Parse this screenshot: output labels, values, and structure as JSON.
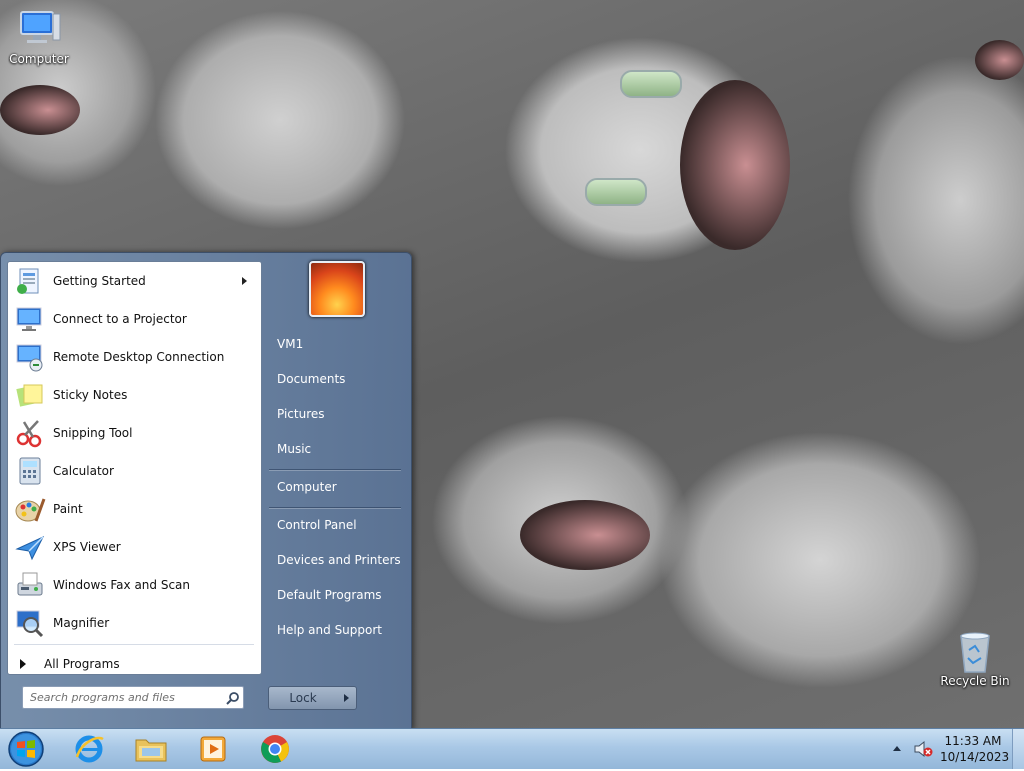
{
  "desktop": {
    "icons": [
      {
        "label": "Computer",
        "icon": "computer-icon"
      },
      {
        "label": "Recycle Bin",
        "icon": "recycle-bin-icon"
      }
    ]
  },
  "start_menu": {
    "programs": [
      {
        "label": "Getting Started",
        "icon": "getting-started-icon",
        "has_submenu": true
      },
      {
        "label": "Connect to a Projector",
        "icon": "projector-icon"
      },
      {
        "label": "Remote Desktop Connection",
        "icon": "remote-desktop-icon"
      },
      {
        "label": "Sticky Notes",
        "icon": "sticky-notes-icon"
      },
      {
        "label": "Snipping Tool",
        "icon": "snipping-tool-icon"
      },
      {
        "label": "Calculator",
        "icon": "calculator-icon"
      },
      {
        "label": "Paint",
        "icon": "paint-icon"
      },
      {
        "label": "XPS Viewer",
        "icon": "xps-viewer-icon"
      },
      {
        "label": "Windows Fax and Scan",
        "icon": "fax-scan-icon"
      },
      {
        "label": "Magnifier",
        "icon": "magnifier-icon"
      }
    ],
    "all_programs": "All Programs",
    "search_placeholder": "Search programs and files",
    "right_links": [
      {
        "label": "VM1"
      },
      {
        "label": "Documents"
      },
      {
        "label": "Pictures"
      },
      {
        "label": "Music"
      },
      {
        "label": "Computer"
      },
      {
        "label": "Control Panel"
      },
      {
        "label": "Devices and Printers"
      },
      {
        "label": "Default Programs"
      },
      {
        "label": "Help and Support"
      }
    ],
    "lock_label": "Lock"
  },
  "taskbar": {
    "pinned": [
      {
        "icon": "internet-explorer-icon"
      },
      {
        "icon": "file-explorer-icon"
      },
      {
        "icon": "media-player-icon"
      },
      {
        "icon": "chrome-icon"
      }
    ],
    "clock_time": "11:33 AM",
    "clock_date": "10/14/2023"
  },
  "colors": {
    "accent": "#5a7396",
    "taskbar": "#a9c8e6"
  }
}
